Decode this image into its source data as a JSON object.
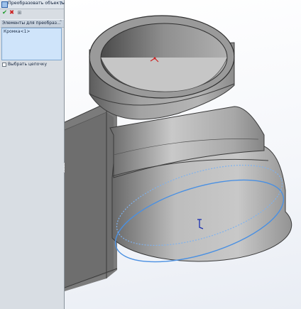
{
  "panel": {
    "title": "Преобразовать объекты",
    "group_title": "Элементы для преобраз...",
    "selection_items": [
      "Кромка<1>"
    ],
    "chain_label": "Выбрать цепочку",
    "chain_checked": false,
    "icons": {
      "help": "help-icon",
      "ok": "checkmark-icon",
      "cancel": "close-icon",
      "pin": "pushpin-icon"
    }
  },
  "colors": {
    "panel_bg": "#d8dde3",
    "list_bg": "#cfe4fa",
    "edge_highlight": "#4a90e2"
  }
}
